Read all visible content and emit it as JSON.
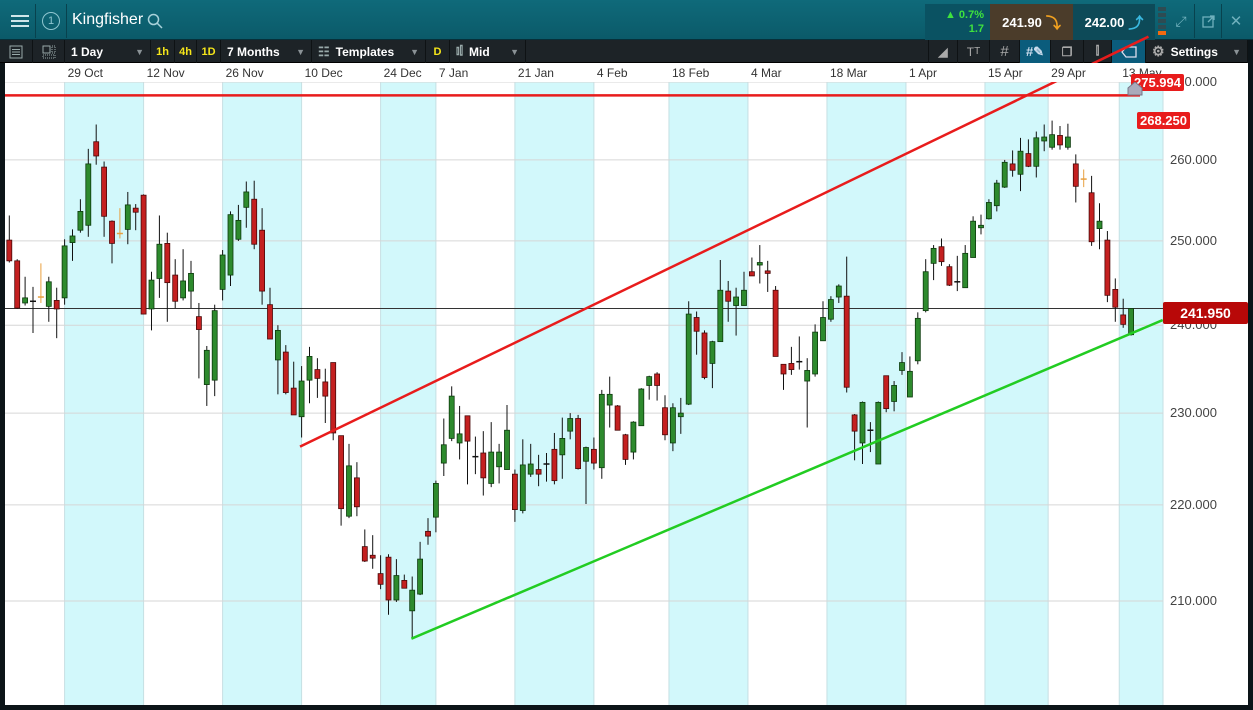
{
  "header": {
    "instrument": "Kingfisher",
    "tab_number": "1",
    "change_pct": "▲ 0.7%",
    "change_abs": "1.7",
    "sell_price": "241.90",
    "buy_price": "242.00"
  },
  "toolbar": {
    "interval": "1 Day",
    "quick_intervals": [
      "1h",
      "4h",
      "1D"
    ],
    "range": "7 Months",
    "templates": "Templates",
    "d_label": "D",
    "price_type": "Mid",
    "settings": "Settings"
  },
  "colors": {
    "up": "#2d8a2d",
    "down": "#c42020",
    "doji_alt": "#e8a040",
    "band": "#d2f8fb",
    "channel_upper": "#e81c1c",
    "channel_lower": "#22cc22",
    "resistance": "#e81c1c"
  },
  "chart_data": {
    "type": "candlestick",
    "scale": "log",
    "ylim": [
      200,
      270
    ],
    "y_ticks": [
      "270.000",
      "260.000",
      "250.000",
      "240.000",
      "230.000",
      "220.000",
      "210.000"
    ],
    "y_tick_values": [
      270,
      260,
      250,
      240,
      230,
      220,
      210
    ],
    "date_ticks": [
      {
        "label": "29 Oct",
        "index": 8
      },
      {
        "label": "12 Nov",
        "index": 18
      },
      {
        "label": "26 Nov",
        "index": 28
      },
      {
        "label": "10 Dec",
        "index": 38
      },
      {
        "label": "24 Dec",
        "index": 48
      },
      {
        "label": "7 Jan",
        "index": 55
      },
      {
        "label": "21 Jan",
        "index": 65
      },
      {
        "label": "4 Feb",
        "index": 75
      },
      {
        "label": "18 Feb",
        "index": 84.5
      },
      {
        "label": "4 Mar",
        "index": 94.5
      },
      {
        "label": "18 Mar",
        "index": 104.5
      },
      {
        "label": "1 Apr",
        "index": 114.5
      },
      {
        "label": "15 Apr",
        "index": 124.5
      },
      {
        "label": "29 Apr",
        "index": 132.5
      },
      {
        "label": "13 May",
        "index": 141.5
      }
    ],
    "orange_doji_indices": [
      5,
      15,
      137
    ],
    "ohlc": [
      [
        250.1,
        253.1,
        247.4,
        247.6
      ],
      [
        247.6,
        247.8,
        241.9,
        242.0
      ],
      [
        242.6,
        245.7,
        242.3,
        243.2
      ],
      [
        242.8,
        244.5,
        239.1,
        242.8
      ],
      [
        243.3,
        247.3,
        242.6,
        243.3
      ],
      [
        242.2,
        245.7,
        240.4,
        245.1
      ],
      [
        242.9,
        244.4,
        238.5,
        241.9
      ],
      [
        243.2,
        250.2,
        242.4,
        249.4
      ],
      [
        249.8,
        251.4,
        247.6,
        250.6
      ],
      [
        251.3,
        255.1,
        251.0,
        253.6
      ],
      [
        251.9,
        261.4,
        250.5,
        259.5
      ],
      [
        262.3,
        264.5,
        259.4,
        260.5
      ],
      [
        259.1,
        259.8,
        250.5,
        253.0
      ],
      [
        252.4,
        252.5,
        247.3,
        249.7
      ],
      [
        250.9,
        254.0,
        250.3,
        250.9
      ],
      [
        251.4,
        256.0,
        249.6,
        254.4
      ],
      [
        254.0,
        254.5,
        251.3,
        253.5
      ],
      [
        255.6,
        255.7,
        241.3,
        241.3
      ],
      [
        241.9,
        246.3,
        239.4,
        245.3
      ],
      [
        245.5,
        253.1,
        243.2,
        249.6
      ],
      [
        249.7,
        251.0,
        240.4,
        245.0
      ],
      [
        245.9,
        247.8,
        242.0,
        242.8
      ],
      [
        243.2,
        249.0,
        242.9,
        245.2
      ],
      [
        244.0,
        247.6,
        242.0,
        246.1
      ],
      [
        241.0,
        242.6,
        233.9,
        239.5
      ],
      [
        233.2,
        237.6,
        230.8,
        237.1
      ],
      [
        233.7,
        242.4,
        231.9,
        241.7
      ],
      [
        244.2,
        248.9,
        242.9,
        248.3
      ],
      [
        245.9,
        253.6,
        244.6,
        253.2
      ],
      [
        250.2,
        254.4,
        250.0,
        252.5
      ],
      [
        254.1,
        257.3,
        251.6,
        256.0
      ],
      [
        255.1,
        257.4,
        249.0,
        249.6
      ],
      [
        251.3,
        254.0,
        242.4,
        244.0
      ],
      [
        242.4,
        244.4,
        238.4,
        238.4
      ],
      [
        236.0,
        240.0,
        232.1,
        239.4
      ],
      [
        236.9,
        237.7,
        232.1,
        232.3
      ],
      [
        232.8,
        235.8,
        229.8,
        229.8
      ],
      [
        229.6,
        235.3,
        227.3,
        233.6
      ],
      [
        233.7,
        237.5,
        231.1,
        236.4
      ],
      [
        234.9,
        236.2,
        231.7,
        233.9
      ],
      [
        233.5,
        235.0,
        228.9,
        231.9
      ],
      [
        235.7,
        235.7,
        227.0,
        227.8
      ],
      [
        227.5,
        227.5,
        217.8,
        219.6
      ],
      [
        218.8,
        226.6,
        218.6,
        224.2
      ],
      [
        222.9,
        224.6,
        218.8,
        219.8
      ],
      [
        215.6,
        217.4,
        214.0,
        214.1
      ],
      [
        214.7,
        216.8,
        213.3,
        214.4
      ],
      [
        212.8,
        214.7,
        211.2,
        211.7
      ],
      [
        214.5,
        214.8,
        208.6,
        210.1
      ],
      [
        210.1,
        214.3,
        209.9,
        212.6
      ],
      [
        212.1,
        212.7,
        211.3,
        211.3
      ],
      [
        209.0,
        212.5,
        206.2,
        211.1
      ],
      [
        210.7,
        216.1,
        210.6,
        214.3
      ],
      [
        217.2,
        218.6,
        215.8,
        216.7
      ],
      [
        218.7,
        222.6,
        217.1,
        222.3
      ],
      [
        224.5,
        229.4,
        223.1,
        226.5
      ],
      [
        227.2,
        233.0,
        226.9,
        231.9
      ],
      [
        226.7,
        230.8,
        224.9,
        227.7
      ],
      [
        229.7,
        229.7,
        222.2,
        226.9
      ],
      [
        225.2,
        227.4,
        223.3,
        225.2
      ],
      [
        225.6,
        228.0,
        221.0,
        222.9
      ],
      [
        222.3,
        229.0,
        221.9,
        225.7
      ],
      [
        224.1,
        226.6,
        222.3,
        225.7
      ],
      [
        223.8,
        230.9,
        223.8,
        228.1
      ],
      [
        223.3,
        223.8,
        218.2,
        219.5
      ],
      [
        219.4,
        227.1,
        219.1,
        224.3
      ],
      [
        223.3,
        226.6,
        223.0,
        224.4
      ],
      [
        223.8,
        225.4,
        222.0,
        223.3
      ],
      [
        224.4,
        225.6,
        222.5,
        224.4
      ],
      [
        226.0,
        227.8,
        222.2,
        222.6
      ],
      [
        225.4,
        229.5,
        222.8,
        227.2
      ],
      [
        228.0,
        230.0,
        227.1,
        229.4
      ],
      [
        229.4,
        229.8,
        223.8,
        223.9
      ],
      [
        224.7,
        226.3,
        220.1,
        226.2
      ],
      [
        226.0,
        227.3,
        223.8,
        224.5
      ],
      [
        224.0,
        232.6,
        222.8,
        232.1
      ],
      [
        230.9,
        234.1,
        228.4,
        232.1
      ],
      [
        230.8,
        230.9,
        228.1,
        228.1
      ],
      [
        227.6,
        227.7,
        224.3,
        224.9
      ],
      [
        225.7,
        229.1,
        224.9,
        229.0
      ],
      [
        228.6,
        232.8,
        228.6,
        232.7
      ],
      [
        233.1,
        234.2,
        231.5,
        234.1
      ],
      [
        234.4,
        234.6,
        231.4,
        233.1
      ],
      [
        230.6,
        232.0,
        227.0,
        227.6
      ],
      [
        226.7,
        231.1,
        225.8,
        230.6
      ],
      [
        229.6,
        231.7,
        227.7,
        230.0
      ],
      [
        231.0,
        242.8,
        230.9,
        241.3
      ],
      [
        240.9,
        241.6,
        236.6,
        239.3
      ],
      [
        239.1,
        239.4,
        233.8,
        234.0
      ],
      [
        235.6,
        238.2,
        232.8,
        238.1
      ],
      [
        238.1,
        247.7,
        238.1,
        244.1
      ],
      [
        244.0,
        245.2,
        240.4,
        242.8
      ],
      [
        242.3,
        244.4,
        238.8,
        243.3
      ],
      [
        242.3,
        246.3,
        242.3,
        244.1
      ],
      [
        246.3,
        248.0,
        245.8,
        245.8
      ],
      [
        247.1,
        249.5,
        244.9,
        247.4
      ],
      [
        246.4,
        247.6,
        243.9,
        246.1
      ],
      [
        244.1,
        244.6,
        236.4,
        236.4
      ],
      [
        235.5,
        235.5,
        232.6,
        234.4
      ],
      [
        235.6,
        237.5,
        234.3,
        234.9
      ],
      [
        235.8,
        238.7,
        234.9,
        235.8
      ],
      [
        233.6,
        236.2,
        228.4,
        234.8
      ],
      [
        234.4,
        240.1,
        234.1,
        239.2
      ],
      [
        238.2,
        242.8,
        238.2,
        240.9
      ],
      [
        240.7,
        243.4,
        240.4,
        243.0
      ],
      [
        243.3,
        244.8,
        242.6,
        244.6
      ],
      [
        243.4,
        248.1,
        232.3,
        232.9
      ],
      [
        229.8,
        229.9,
        224.8,
        228.0
      ],
      [
        226.7,
        231.3,
        224.4,
        231.2
      ],
      [
        228.1,
        229.0,
        225.7,
        228.1
      ],
      [
        224.4,
        231.3,
        224.4,
        231.2
      ],
      [
        234.2,
        234.2,
        230.1,
        230.5
      ],
      [
        231.3,
        233.6,
        230.2,
        233.1
      ],
      [
        234.8,
        236.9,
        234.3,
        235.7
      ],
      [
        231.8,
        236.4,
        231.8,
        234.7
      ],
      [
        235.9,
        241.5,
        235.5,
        240.8
      ],
      [
        241.7,
        247.8,
        241.5,
        246.3
      ],
      [
        247.3,
        249.5,
        245.3,
        249.1
      ],
      [
        249.3,
        250.3,
        247.0,
        247.5
      ],
      [
        246.9,
        247.2,
        244.6,
        244.7
      ],
      [
        245.1,
        248.2,
        244.0,
        245.1
      ],
      [
        244.4,
        249.5,
        244.4,
        248.5
      ],
      [
        248.0,
        253.0,
        248.0,
        252.4
      ],
      [
        251.6,
        253.2,
        250.8,
        251.9
      ],
      [
        252.7,
        255.1,
        252.6,
        254.7
      ],
      [
        254.3,
        257.5,
        253.6,
        257.1
      ],
      [
        256.6,
        260.0,
        256.5,
        259.7
      ],
      [
        259.5,
        261.2,
        257.9,
        258.7
      ],
      [
        258.2,
        262.8,
        256.1,
        261.1
      ],
      [
        260.8,
        262.6,
        259.1,
        259.2
      ],
      [
        259.2,
        263.6,
        257.8,
        262.8
      ],
      [
        262.4,
        264.5,
        261.1,
        262.9
      ],
      [
        261.6,
        265.0,
        261.3,
        263.2
      ],
      [
        263.1,
        264.3,
        261.3,
        261.9
      ],
      [
        261.6,
        264.6,
        261.3,
        262.9
      ],
      [
        259.5,
        260.7,
        254.7,
        256.7
      ],
      [
        257.6,
        258.8,
        256.6,
        257.6
      ],
      [
        255.9,
        258.0,
        249.4,
        249.9
      ],
      [
        251.5,
        254.6,
        249.0,
        252.4
      ],
      [
        250.1,
        251.2,
        242.7,
        243.5
      ],
      [
        244.2,
        245.5,
        240.4,
        242.1
      ],
      [
        241.2,
        243.1,
        239.7,
        240.1
      ],
      [
        238.9,
        241.8,
        238.8,
        241.95
      ]
    ],
    "trendlines": [
      {
        "name": "upper-channel",
        "from": {
          "index": 37.8,
          "price": 226.3
        },
        "to": {
          "index": 145.2,
          "price": 275.994
        },
        "label": "275.994"
      },
      {
        "name": "lower-channel",
        "from": {
          "index": 51.9,
          "price": 206.2
        },
        "to": {
          "index": 147,
          "price": 240.6
        }
      }
    ],
    "horizontal_line": {
      "price": 268.25,
      "label": "268.250"
    },
    "current_price": {
      "price": 241.95,
      "label": "241.950"
    }
  }
}
